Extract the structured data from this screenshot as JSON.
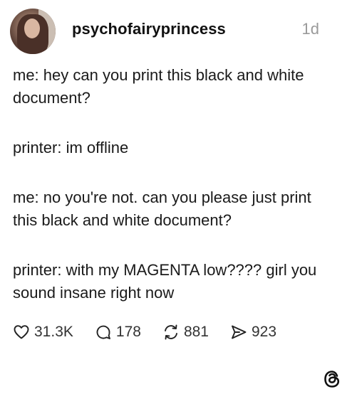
{
  "post": {
    "username": "psychofairyprincess",
    "timestamp": "1d",
    "paragraphs": [
      "me: hey can you print this black and white document?",
      "printer: im offline",
      "me: no you're not. can you please just print this black and white document?",
      "printer: with my MAGENTA low???? girl you sound insane right now"
    ],
    "stats": {
      "likes": "31.3K",
      "replies": "178",
      "reposts": "881",
      "shares": "923"
    }
  },
  "icons": {
    "like": "heart-icon",
    "reply": "speech-bubble-icon",
    "repost": "repost-icon",
    "share": "send-icon",
    "brand": "threads-logo-icon"
  }
}
